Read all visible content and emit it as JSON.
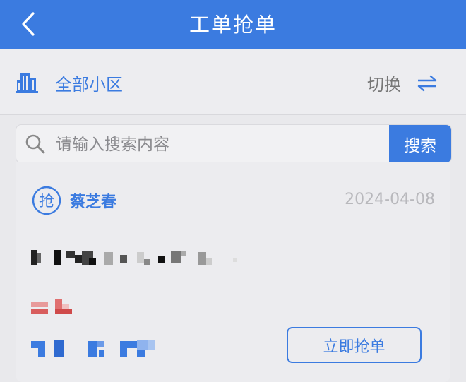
{
  "header": {
    "title": "工单抢单"
  },
  "community": {
    "name": "全部小区",
    "switch_label": "切换"
  },
  "search": {
    "placeholder": "请输入搜索内容",
    "button_label": "搜索"
  },
  "order": {
    "grab_icon_char": "抢",
    "requester_name": "蔡芝春",
    "date": "2024-04-08",
    "action_label": "立即抢单"
  },
  "colors": {
    "primary": "#3b7be0",
    "background": "#e9e9ec"
  }
}
